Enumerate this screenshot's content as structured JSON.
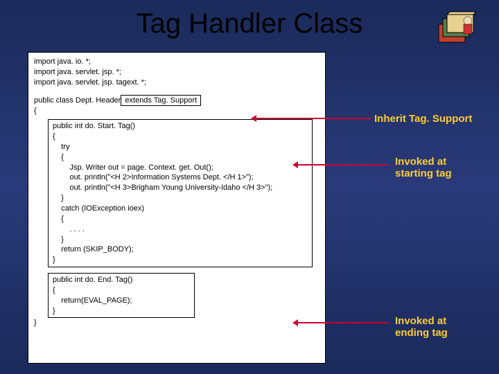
{
  "title": "Tag Handler Class",
  "code": {
    "imports": [
      "import java. io. *;",
      "import java. servlet. jsp. *;",
      "import java. servlet. jsp. tagext. *;"
    ],
    "class_prefix": "public class Dept. Header",
    "class_extends": " extends Tag. Support ",
    "brace_open": "{",
    "method1": {
      "lines": [
        "public int do. Start. Tag()",
        "{",
        "    try",
        "    {",
        "        Jsp. Writer out = page. Context. get. Out();",
        "        out. println(\"<H 2>Information Systems Dept. </H 1>\");",
        "        out. println(\"<H 3>Brigham Young University-Idaho </H 3>\");",
        "    }",
        "    catch (IOException ioex)",
        "    {",
        "        . . . .",
        "    }",
        "",
        "    return (SKIP_BODY);",
        "}"
      ]
    },
    "method2": {
      "lines": [
        "public int do. End. Tag()",
        "{",
        "    return(EVAL_PAGE);",
        "}"
      ]
    },
    "brace_close": "}"
  },
  "annotations": {
    "inherit": "Inherit Tag. Support",
    "invoked_start_l1": "Invoked at",
    "invoked_start_l2": "starting tag",
    "invoked_end_l1": "Invoked at",
    "invoked_end_l2": "ending tag"
  }
}
